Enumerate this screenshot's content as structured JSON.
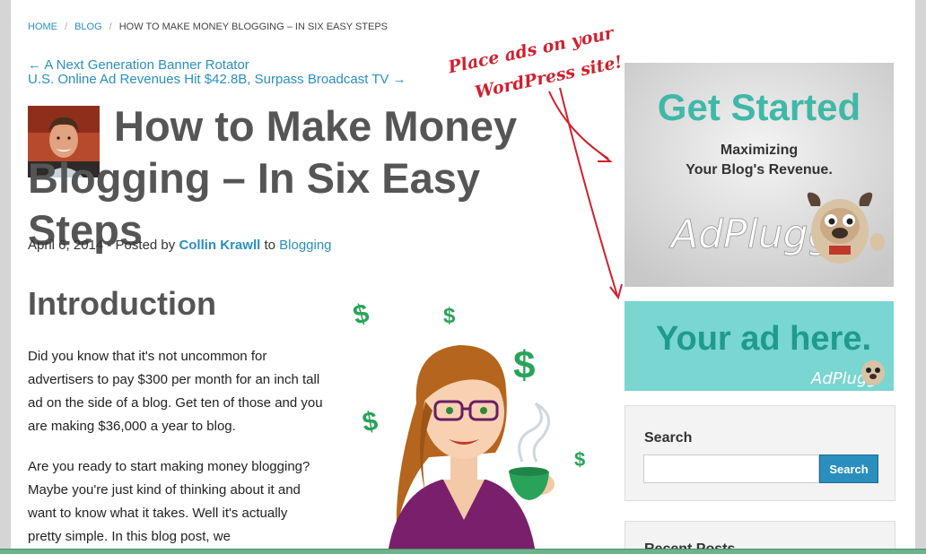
{
  "breadcrumb": {
    "home": "HOME",
    "sep1": "/",
    "blog": "BLOG",
    "sep2": "/",
    "current": "HOW TO MAKE MONEY BLOGGING – IN SIX EASY STEPS"
  },
  "post_nav": {
    "prev": "← A Next Generation Banner Rotator",
    "next": "U.S. Online Ad Revenues Hit $42.8B, Surpass Broadcast TV →"
  },
  "post": {
    "title": "How to Make Money Blogging – In Six Easy Steps",
    "date_prefix": "April 6, 2014 - Posted by ",
    "author": "Collin Krawll",
    "to_text": " to ",
    "category": "Blogging",
    "heading": "Introduction",
    "para1": "Did you know that it's not uncommon for advertisers to pay $300 per month for an inch tall ad on the side of a blog. Get ten of those and you are making $36,000 a year to blog.",
    "para2": "Are you ready to start making money blogging? Maybe you're just kind of thinking about it and want to know what it takes. Well it's actually pretty simple. In this blog post, we"
  },
  "illustration": {
    "dollar_sign": "$"
  },
  "callout": {
    "line1": "Place ads on your",
    "line2": "WordPress site!"
  },
  "ad1": {
    "headline": "Get Started",
    "line1": "Maximizing",
    "line2": "Your Blog's Revenue.",
    "brand": "AdPlugg"
  },
  "ad2": {
    "headline": "Your ad here.",
    "brand": "AdPlugg"
  },
  "sidebar": {
    "search_title": "Search",
    "search_value": "",
    "search_button": "Search",
    "recent_title": "Recent Posts"
  },
  "colors": {
    "link": "#2a8fbd",
    "title": "#555555",
    "callout": "#d0202e",
    "ad1_headline": "#3fb8a8",
    "ad2_bg": "#79d6d1",
    "dollar": "#2aa35a"
  }
}
